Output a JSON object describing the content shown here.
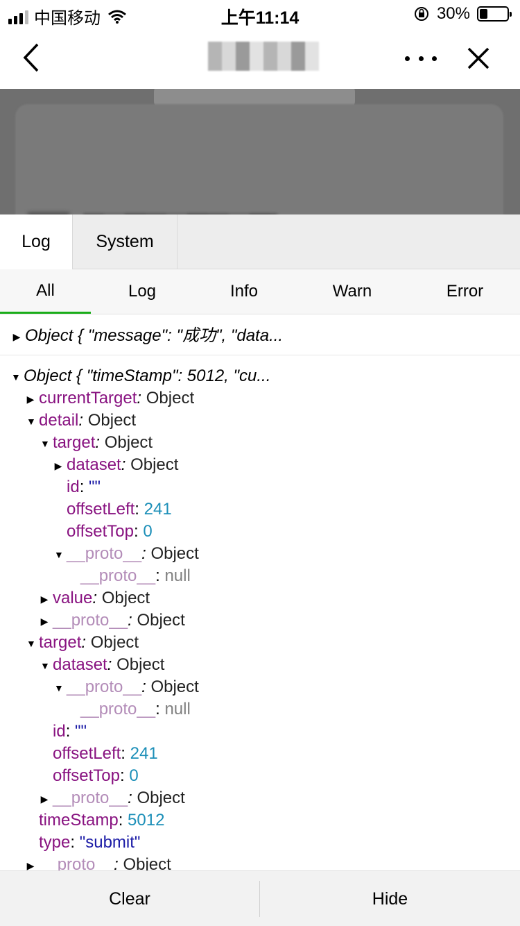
{
  "status_bar": {
    "carrier": "中国移动",
    "time": "上午11:14",
    "battery_text": "30%",
    "battery_level": 0.3
  },
  "nav": {
    "back_icon": "chevron-left-icon",
    "more_icon": "more-horizontal-icon",
    "close_icon": "close-icon"
  },
  "console": {
    "top_tabs": [
      {
        "label": "Log",
        "active": true
      },
      {
        "label": "System",
        "active": false
      }
    ],
    "filter_tabs": [
      {
        "label": "All",
        "active": true
      },
      {
        "label": "Log",
        "active": false
      },
      {
        "label": "Info",
        "active": false
      },
      {
        "label": "Warn",
        "active": false
      },
      {
        "label": "Error",
        "active": false
      }
    ],
    "entries": [
      {
        "summary": "Object { \"message\": \"成功\", \"data...",
        "expanded": false
      },
      {
        "summary": "Object { \"timeStamp\": 5012, \"cu...",
        "expanded": true
      }
    ],
    "tree": [
      {
        "toggle": "closed",
        "key": "currentTarget",
        "italic_colon": true,
        "value": "Object",
        "vtype": "obj"
      },
      {
        "toggle": "open",
        "key": "detail",
        "italic_colon": true,
        "value": "Object",
        "vtype": "obj"
      },
      {
        "toggle": "open",
        "key": "target",
        "italic_colon": true,
        "value": "Object",
        "vtype": "obj"
      },
      {
        "toggle": "closed",
        "key": "dataset",
        "italic_colon": true,
        "value": "Object",
        "vtype": "obj"
      },
      {
        "toggle": "none",
        "key": "id",
        "value": "\"\"",
        "vtype": "str"
      },
      {
        "toggle": "none",
        "key": "offsetLeft",
        "value": "241",
        "vtype": "num"
      },
      {
        "toggle": "none",
        "key": "offsetTop",
        "value": "0",
        "vtype": "num"
      },
      {
        "toggle": "open",
        "key": "__proto__",
        "italic_colon": true,
        "value": "Object",
        "vtype": "obj",
        "proto": true
      },
      {
        "toggle": "none",
        "key": "__proto__",
        "value": "null",
        "vtype": "null",
        "proto": true
      },
      {
        "toggle": "closed",
        "key": "value",
        "italic_colon": true,
        "value": "Object",
        "vtype": "obj"
      },
      {
        "toggle": "closed",
        "key": "__proto__",
        "italic_colon": true,
        "value": "Object",
        "vtype": "obj",
        "proto": true
      },
      {
        "toggle": "open",
        "key": "target",
        "italic_colon": true,
        "value": "Object",
        "vtype": "obj"
      },
      {
        "toggle": "open",
        "key": "dataset",
        "italic_colon": true,
        "value": "Object",
        "vtype": "obj"
      },
      {
        "toggle": "open",
        "key": "__proto__",
        "italic_colon": true,
        "value": "Object",
        "vtype": "obj",
        "proto": true
      },
      {
        "toggle": "none",
        "key": "__proto__",
        "value": "null",
        "vtype": "null",
        "proto": true
      },
      {
        "toggle": "none",
        "key": "id",
        "value": "\"\"",
        "vtype": "str"
      },
      {
        "toggle": "none",
        "key": "offsetLeft",
        "value": "241",
        "vtype": "num"
      },
      {
        "toggle": "none",
        "key": "offsetTop",
        "value": "0",
        "vtype": "num"
      },
      {
        "toggle": "closed",
        "key": "__proto__",
        "italic_colon": true,
        "value": "Object",
        "vtype": "obj",
        "proto": true
      },
      {
        "toggle": "none",
        "key": "timeStamp",
        "value": "5012",
        "vtype": "num"
      },
      {
        "toggle": "none",
        "key": "type",
        "value": "\"submit\"",
        "vtype": "str"
      },
      {
        "toggle": "closed",
        "key": "__proto__",
        "italic_colon": true,
        "value": "Object",
        "vtype": "obj",
        "proto": true
      }
    ],
    "bottom": {
      "clear_label": "Clear",
      "hide_label": "Hide"
    }
  },
  "colors": {
    "key": "#881280",
    "proto_key": "#b38cb8",
    "number": "#1c8fb8",
    "string": "#1a1aa6",
    "active_tab_underline": "#1aad19"
  }
}
